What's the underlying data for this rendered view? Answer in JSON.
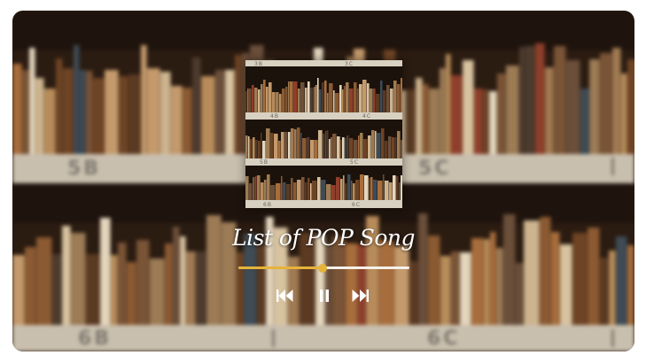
{
  "player": {
    "song_title": "List of POP Song",
    "progress": 0.49,
    "accent_color": "#e5b33a",
    "controls": {
      "previous_icon": "skip-back-icon",
      "play_pause_icon": "pause-icon",
      "next_icon": "skip-forward-icon"
    },
    "background": {
      "shelf_labels": [
        "5B",
        "5C",
        "6B",
        "6C"
      ]
    },
    "cover": {
      "shelf_labels": [
        "3B",
        "3C",
        "4B",
        "4C",
        "5B",
        "5C",
        "6B",
        "6C"
      ]
    }
  }
}
